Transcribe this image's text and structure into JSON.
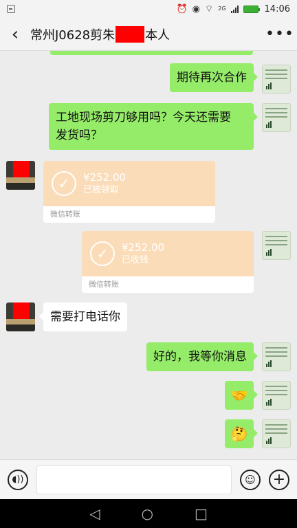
{
  "status_bar": {
    "network": "2G",
    "time": "14:06"
  },
  "header": {
    "title_prefix": "常州J0628剪朱",
    "title_suffix": "本人",
    "back_icon": "chevron-left-icon",
    "more_icon": "more-dots-icon"
  },
  "messages": [
    {
      "side": "right",
      "type": "text",
      "text": "期待再次合作"
    },
    {
      "side": "right",
      "type": "text",
      "lines": [
        "工地现场剪刀够用吗？今天还需要",
        "发货吗？"
      ]
    },
    {
      "side": "left",
      "type": "transfer",
      "amount": "¥252.00",
      "status": "已被领取",
      "footer": "微信转账"
    },
    {
      "side": "right",
      "type": "transfer",
      "amount": "¥252.00",
      "status": "已收钱",
      "footer": "微信转账"
    },
    {
      "side": "left",
      "type": "text",
      "text": "需要打电话你"
    },
    {
      "side": "right",
      "type": "text",
      "text": "好的，我等你消息"
    },
    {
      "side": "right",
      "type": "emoji",
      "icon": "handshake-emoji-icon",
      "glyph": "🤝"
    },
    {
      "side": "right",
      "type": "emoji",
      "icon": "thinking-emoji-icon",
      "glyph": "🤔"
    }
  ],
  "input_bar": {
    "voice_icon": "voice-icon",
    "emoji_icon": "smiley-icon",
    "plus_icon": "plus-icon"
  },
  "nav_bar": {
    "back": "◁",
    "home": "○",
    "recent": "□"
  },
  "colors": {
    "self_bubble": "#95ec69",
    "other_bubble": "#ffffff",
    "transfer_card": "#fbdcb8",
    "chat_bg": "#ececec"
  }
}
